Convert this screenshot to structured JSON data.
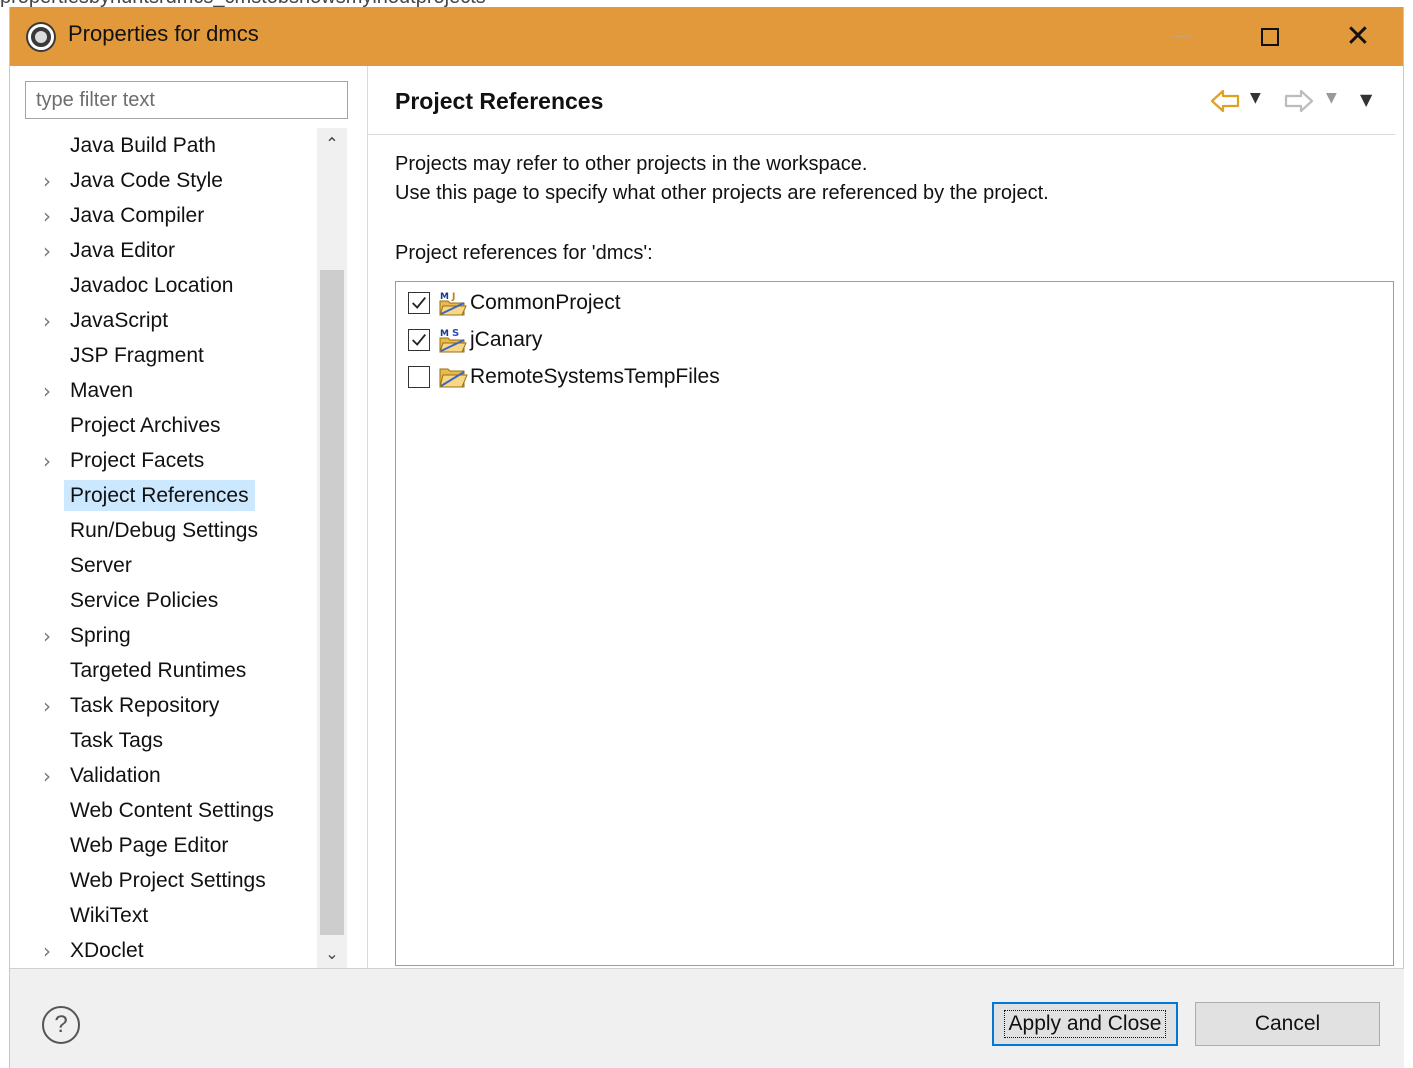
{
  "top_strip_text": "propertiesbyhuntsrdmcs_cmstobshowsmyinoutprojects",
  "window": {
    "title": "Properties for dmcs",
    "title_bar_color": "#e2993b",
    "controls": {
      "minimize": "minimize-icon",
      "maximize": "maximize-icon",
      "close": "✕"
    }
  },
  "sidebar": {
    "filter_placeholder": "type filter text",
    "items": [
      {
        "label": "Java Build Path",
        "expandable": false
      },
      {
        "label": "Java Code Style",
        "expandable": true
      },
      {
        "label": "Java Compiler",
        "expandable": true
      },
      {
        "label": "Java Editor",
        "expandable": true
      },
      {
        "label": "Javadoc Location",
        "expandable": false
      },
      {
        "label": "JavaScript",
        "expandable": true
      },
      {
        "label": "JSP Fragment",
        "expandable": false
      },
      {
        "label": "Maven",
        "expandable": true
      },
      {
        "label": "Project Archives",
        "expandable": false
      },
      {
        "label": "Project Facets",
        "expandable": true
      },
      {
        "label": "Project References",
        "expandable": false,
        "selected": true
      },
      {
        "label": "Run/Debug Settings",
        "expandable": false
      },
      {
        "label": "Server",
        "expandable": false
      },
      {
        "label": "Service Policies",
        "expandable": false
      },
      {
        "label": "Spring",
        "expandable": true
      },
      {
        "label": "Targeted Runtimes",
        "expandable": false
      },
      {
        "label": "Task Repository",
        "expandable": true
      },
      {
        "label": "Task Tags",
        "expandable": false
      },
      {
        "label": "Validation",
        "expandable": true
      },
      {
        "label": "Web Content Settings",
        "expandable": false
      },
      {
        "label": "Web Page Editor",
        "expandable": false
      },
      {
        "label": "Web Project Settings",
        "expandable": false
      },
      {
        "label": "WikiText",
        "expandable": false
      },
      {
        "label": "XDoclet",
        "expandable": true
      }
    ],
    "selection_color": "#cce8ff"
  },
  "page": {
    "title": "Project References",
    "description_line1": "Projects may refer to other projects in the workspace.",
    "description_line2": "Use this page to specify what other projects are referenced by the project.",
    "refs_label": "Project references for 'dmcs':",
    "references": [
      {
        "name": "CommonProject",
        "checked": true,
        "icon": "maven-java-project-icon"
      },
      {
        "name": "jCanary",
        "checked": true,
        "icon": "maven-spring-project-icon"
      },
      {
        "name": "RemoteSystemsTempFiles",
        "checked": false,
        "icon": "open-folder-icon"
      }
    ],
    "nav": {
      "back": "back-arrow-icon",
      "forward": "forward-arrow-icon",
      "menu": "view-menu-icon"
    }
  },
  "footer": {
    "help_glyph": "?",
    "apply_label": "Apply and Close",
    "cancel_label": "Cancel",
    "focus_color": "#0078d7"
  }
}
